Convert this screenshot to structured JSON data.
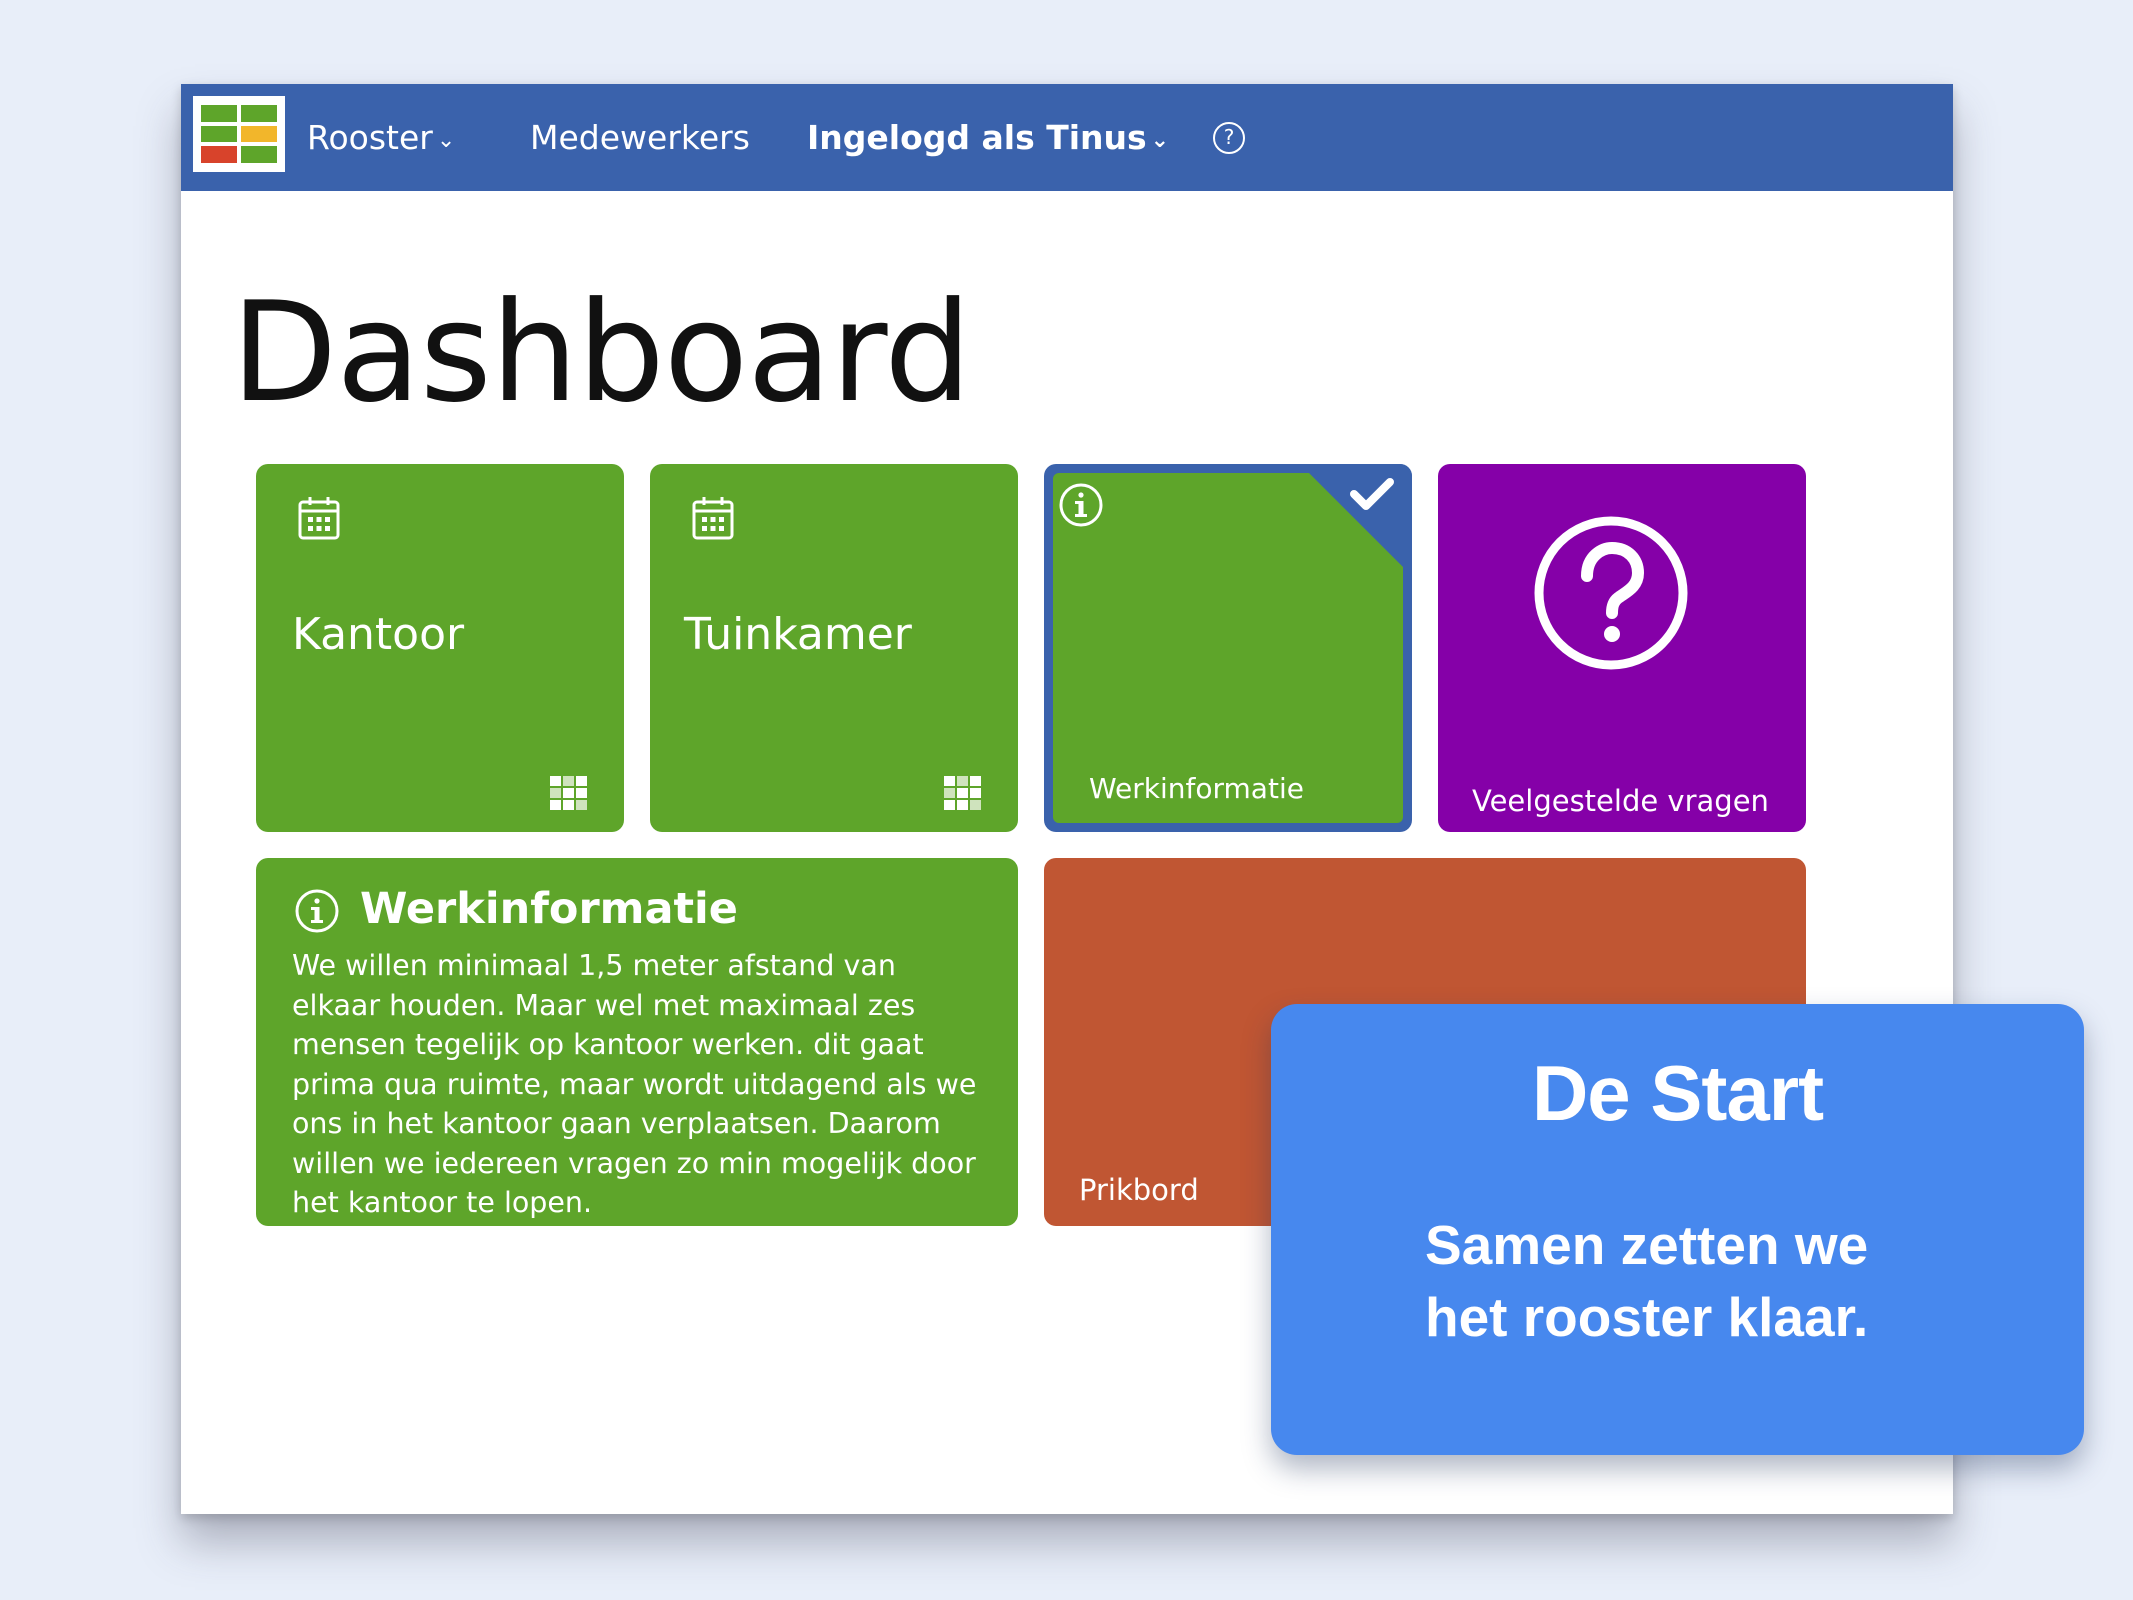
{
  "nav": {
    "logo_icon": "rooster-grid-logo",
    "items": [
      {
        "label": "Rooster",
        "has_dropdown": true
      },
      {
        "label": "Medewerkers",
        "has_dropdown": false
      },
      {
        "label": "Ingelogd als Tinus",
        "has_dropdown": true
      }
    ],
    "chevron": "⌄",
    "help_glyph": "?"
  },
  "page": {
    "title": "Dashboard"
  },
  "tiles": {
    "kantoor": {
      "label": "Kantoor",
      "icon": "calendar-icon",
      "corner_icon": "grid-icon",
      "color": "#5ea52a"
    },
    "tuinkamer": {
      "label": "Tuinkamer",
      "icon": "calendar-icon",
      "corner_icon": "grid-icon",
      "color": "#5ea52a"
    },
    "werkinformatie": {
      "label": "Werkinformatie",
      "icon": "info-icon",
      "selected": true,
      "border_color": "#3a62ac",
      "color": "#5ea52a"
    },
    "faq": {
      "label": "Veelgestelde vragen",
      "icon": "question-circle-icon",
      "color": "#8500a8"
    },
    "info_panel": {
      "title": "Werkinformatie",
      "icon": "info-icon",
      "color": "#5ea52a",
      "lines": [
        "We willen minimaal 1,5 meter afstand van",
        "elkaar houden. Maar wel met maximaal zes",
        "mensen tegelijk op kantoor werken. dit gaat",
        "prima qua ruimte, maar wordt uitdagend als we",
        "ons in het kantoor gaan verplaatsen. Daarom",
        "willen we iedereen vragen zo min mogelijk door",
        "het kantoor te lopen."
      ]
    },
    "prikbord": {
      "label": "Prikbord",
      "color": "#c05633"
    }
  },
  "overlay": {
    "title": "De Start",
    "subtitle_lines": [
      "Samen zetten we",
      "het rooster klaar."
    ],
    "color": "#4788ee"
  }
}
